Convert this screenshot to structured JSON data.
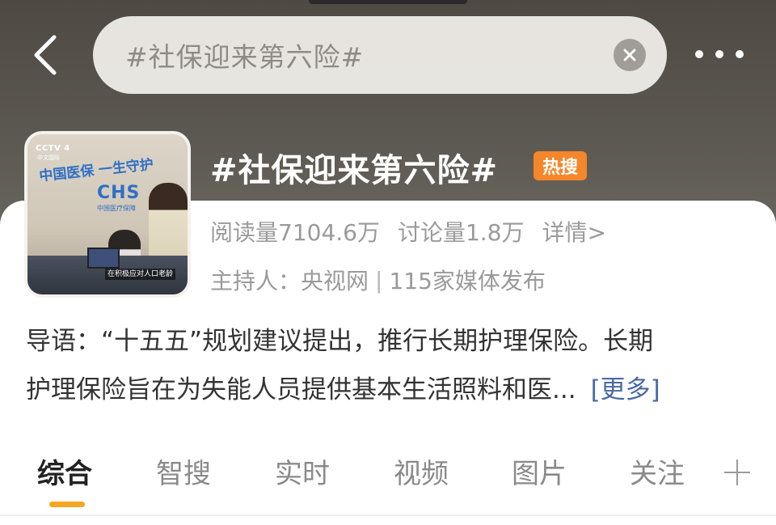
{
  "header": {
    "search_text": "#社保迎来第六险#",
    "back_icon": "chevron-left-icon",
    "clear_icon": "close-icon",
    "more_icon": "more-horizontal-icon"
  },
  "topic": {
    "title": "#社保迎来第六险#",
    "hot_badge": "热搜",
    "reads": "阅读量7104.6万",
    "discussions": "讨论量1.8万",
    "details_link": "详情>",
    "host_label": "主持人：央视网",
    "host_separator": "|",
    "media_count": "115家媒体发布"
  },
  "thumbnail": {
    "channel": "CCTV 4",
    "channel_sub": "中文国际",
    "slogan": "中国医保 一生守护",
    "logo": "CHS",
    "logo_sub": "中国医疗保障",
    "caption": "在积极应对人口老龄"
  },
  "intro": {
    "line1": "导语：“十五五”规划建议提出，推行长期护理保险。长期",
    "line2": "护理保险旨在为失能人员提供基本生活照料和医...",
    "more_link": "[更多]"
  },
  "tabs": [
    {
      "label": "综合",
      "active": true
    },
    {
      "label": "智搜",
      "active": false
    },
    {
      "label": "实时",
      "active": false
    },
    {
      "label": "视频",
      "active": false
    },
    {
      "label": "图片",
      "active": false
    },
    {
      "label": "关注",
      "active": false
    }
  ],
  "colors": {
    "accent": "#f5a623",
    "hot_badge": "#f5862a",
    "link": "#4a6aa0"
  }
}
